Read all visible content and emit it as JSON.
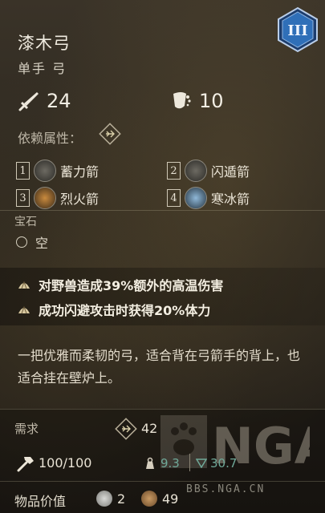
{
  "item": {
    "tier": "III",
    "name": "漆木弓",
    "type": "单手 弓",
    "damage": "24",
    "defense": "10"
  },
  "dependency": {
    "label": "依赖属性："
  },
  "skills": [
    {
      "num": "1",
      "name": "蓄力箭"
    },
    {
      "num": "2",
      "name": "闪遁箭"
    },
    {
      "num": "3",
      "name": "烈火箭"
    },
    {
      "num": "4",
      "name": "寒冰箭"
    }
  ],
  "gem": {
    "label": "宝石",
    "slot": "空"
  },
  "effects": [
    {
      "prefix": "对野兽造成",
      "value": "39%",
      "suffix": "额外的高温伤害"
    },
    {
      "prefix": "成功闪避攻击时获得",
      "value": "20%",
      "suffix": "体力"
    }
  ],
  "description": "一把优雅而柔韧的弓，适合背在弓箭手的背上，也适合挂在壁炉上。",
  "requirements": {
    "label": "需求",
    "value": "42"
  },
  "durability": {
    "value": "100/100"
  },
  "weight": {
    "a": "9.3",
    "b": "30.7"
  },
  "price": {
    "label": "物品价值",
    "silver": "2",
    "copper": "49"
  },
  "watermark": {
    "text": "NGA",
    "url": "BBS.NGA.CN"
  },
  "colors": {
    "accent_blue": "#2f6fb8",
    "weight_green": "#6fa898"
  }
}
